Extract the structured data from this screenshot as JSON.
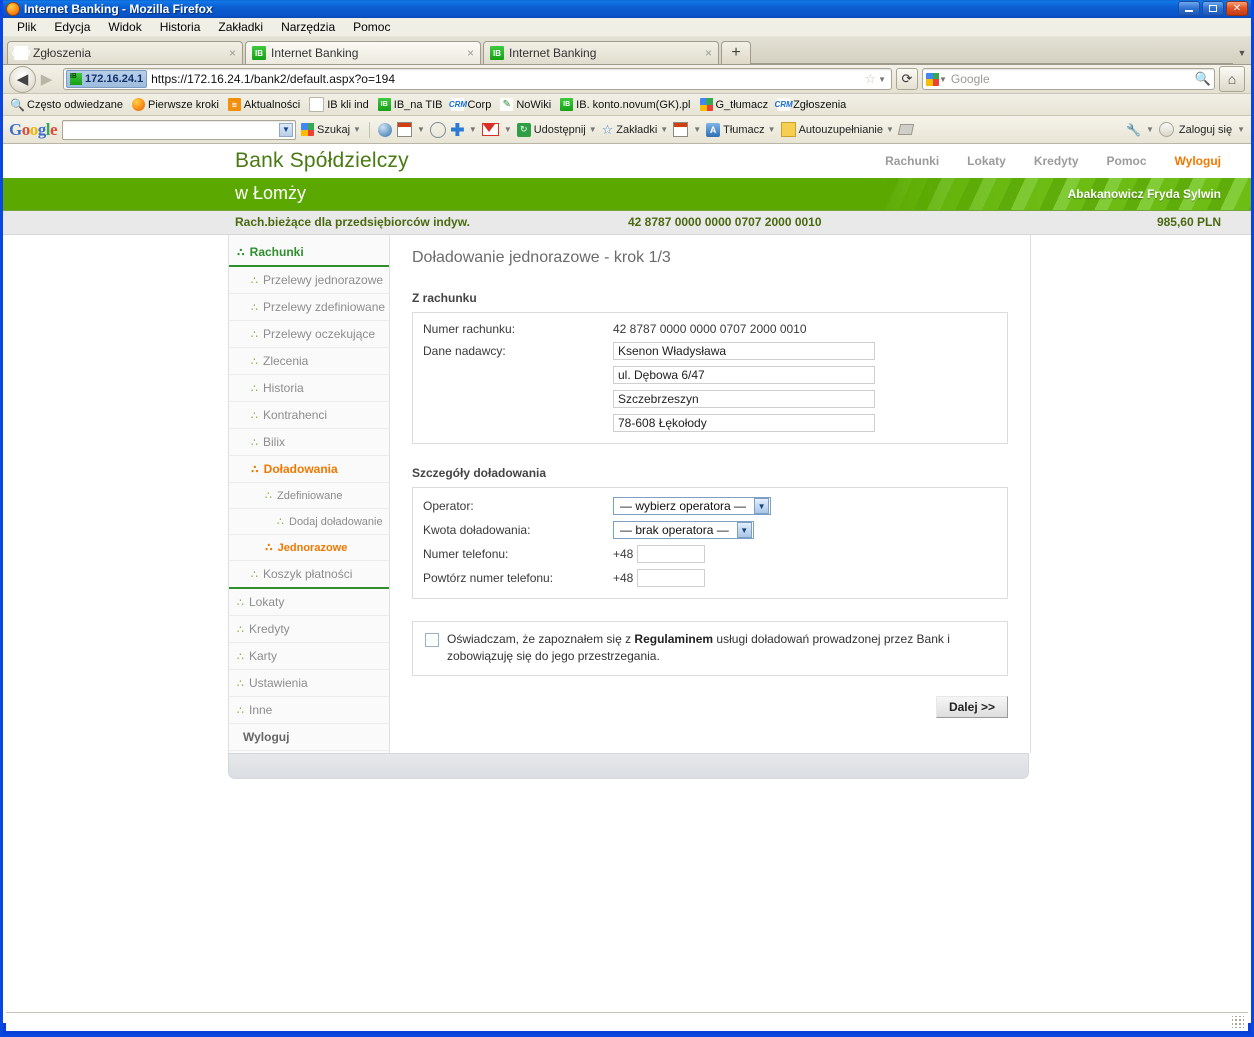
{
  "window": {
    "title": "Internet Banking - Mozilla Firefox",
    "minimize": "–",
    "maximize": "□",
    "close": "✕"
  },
  "menubar": [
    {
      "label": "Plik"
    },
    {
      "label": "Edycja"
    },
    {
      "label": "Widok"
    },
    {
      "label": "Historia"
    },
    {
      "label": "Zakładki"
    },
    {
      "label": "Narzędzia"
    },
    {
      "label": "Pomoc"
    }
  ],
  "tabs": [
    {
      "label": "Zgłoszenia",
      "icon": "crm-icon",
      "favicon_text": "CRM",
      "close": "×",
      "active": false
    },
    {
      "label": "Internet Banking",
      "icon": "ib-icon",
      "favicon_text": "IB",
      "close": "×",
      "active": true
    },
    {
      "label": "Internet Banking",
      "icon": "ib-icon",
      "favicon_text": "IB",
      "close": "×",
      "active": false
    }
  ],
  "newtab_label": "+",
  "navbar": {
    "back": "◀",
    "forward": "▶",
    "identity_badge": "172.16.24.1",
    "identity_favicon": "IB",
    "url": "https://172.16.24.1/bank2/default.aspx?o=194",
    "bookmark_star": "☆",
    "reload": "⟳",
    "search_placeholder": "Google",
    "search_value": "",
    "home": "⌂"
  },
  "bookmarks": [
    {
      "label": "Często odwiedzane",
      "icon": "folder-search-icon"
    },
    {
      "label": "Pierwsze kroki",
      "icon": "firefox-icon"
    },
    {
      "label": "Aktualności",
      "icon": "rss-icon"
    },
    {
      "label": "IB kli ind",
      "icon": "document-icon"
    },
    {
      "label": "IB_na TIB",
      "icon": "ib-icon"
    },
    {
      "label": "Corp",
      "icon": "crm-icon"
    },
    {
      "label": "NoWiki",
      "icon": "nowiki-icon"
    },
    {
      "label": "IB. konto.novum(GK).pl",
      "icon": "ib-icon"
    },
    {
      "label": "G_tłumacz",
      "icon": "google-icon"
    },
    {
      "label": "Zgłoszenia",
      "icon": "crm-icon"
    }
  ],
  "google_toolbar": {
    "logo": "Google",
    "search_value": "",
    "search_label": "Szukaj",
    "items": [
      {
        "label": "Udostępnij",
        "icon": "share-icon"
      },
      {
        "label": "Zakładki",
        "icon": "star-icon"
      },
      {
        "label": "Tłumacz",
        "icon": "translate-icon"
      },
      {
        "label": "Autouzupełnianie",
        "icon": "autofill-icon"
      }
    ],
    "signin_label": "Zaloguj się"
  },
  "bank": {
    "name": "Bank Spółdzielczy",
    "subtitle": "w Łomży",
    "user": "Abakanowicz Fryda Sylwin",
    "topnav": [
      {
        "label": "Rachunki",
        "highlight": false
      },
      {
        "label": "Lokaty",
        "highlight": false
      },
      {
        "label": "Kredyty",
        "highlight": false
      },
      {
        "label": "Pomoc",
        "highlight": false
      },
      {
        "label": "Wyloguj",
        "highlight": true
      }
    ],
    "account_bar": {
      "name": "Rach.bieżące dla przedsiębiorców indyw.",
      "number": "42 8787 0000 0000 0707 2000 0010",
      "balance": "985,60 PLN"
    },
    "colors": {
      "green_band": "#5aa800",
      "accent_green": "#4a7a12",
      "orange": "#f07800"
    }
  },
  "sidebar": {
    "items": [
      {
        "label": "Rachunki",
        "state": "active",
        "level": 0
      },
      {
        "label": "Przelewy jednorazowe",
        "state": "normal",
        "level": 1
      },
      {
        "label": "Przelewy zdefiniowane",
        "state": "normal",
        "level": 1
      },
      {
        "label": "Przelewy oczekujące",
        "state": "normal",
        "level": 1
      },
      {
        "label": "Zlecenia",
        "state": "normal",
        "level": 1
      },
      {
        "label": "Historia",
        "state": "normal",
        "level": 1
      },
      {
        "label": "Kontrahenci",
        "state": "normal",
        "level": 1
      },
      {
        "label": "Bilix",
        "state": "normal",
        "level": 1
      },
      {
        "label": "Doładowania",
        "state": "orange",
        "level": 1
      },
      {
        "label": "Zdefiniowane",
        "state": "normal",
        "level": 2
      },
      {
        "label": "Dodaj doładowanie",
        "state": "normal",
        "level": 3
      },
      {
        "label": "Jednorazowe",
        "state": "orange",
        "level": 2
      },
      {
        "label": "Koszyk płatności",
        "state": "groupend",
        "level": 1
      },
      {
        "label": "Lokaty",
        "state": "normal",
        "level": 0
      },
      {
        "label": "Kredyty",
        "state": "normal",
        "level": 0
      },
      {
        "label": "Karty",
        "state": "normal",
        "level": 0
      },
      {
        "label": "Ustawienia",
        "state": "normal",
        "level": 0
      },
      {
        "label": "Inne",
        "state": "normal",
        "level": 0
      },
      {
        "label": "Wyloguj",
        "state": "logout",
        "level": 0
      }
    ]
  },
  "main": {
    "page_title": "Doładowanie jednorazowe - krok 1/3",
    "section_from": {
      "title": "Z rachunku",
      "account_label": "Numer rachunku:",
      "account_value": "42 8787 0000 0000 0707 2000 0010",
      "sender_label": "Dane nadawcy:",
      "sender_lines": [
        "Ksenon Władysława",
        "ul. Dębowa 6/47",
        "Szczebrzeszyn",
        "78-608 Łękołody"
      ]
    },
    "section_details": {
      "title": "Szczegóły doładowania",
      "operator_label": "Operator:",
      "operator_value": "— wybierz operatora —",
      "amount_label": "Kwota doładowania:",
      "amount_value": "— brak operatora —",
      "phone_label": "Numer telefonu:",
      "phone_prefix": "+48",
      "phone_value": "",
      "phone_repeat_label": "Powtórz numer telefonu:",
      "phone_repeat_prefix": "+48",
      "phone_repeat_value": ""
    },
    "agreement": {
      "text_before": "Oświadczam, że zapoznałem się z ",
      "link": "Regulaminem",
      "text_after": " usługi doładowań prowadzonej przez Bank i zobowiązuję się do jego przestrzegania.",
      "checked": false
    },
    "next_button": "Dalej >>"
  }
}
